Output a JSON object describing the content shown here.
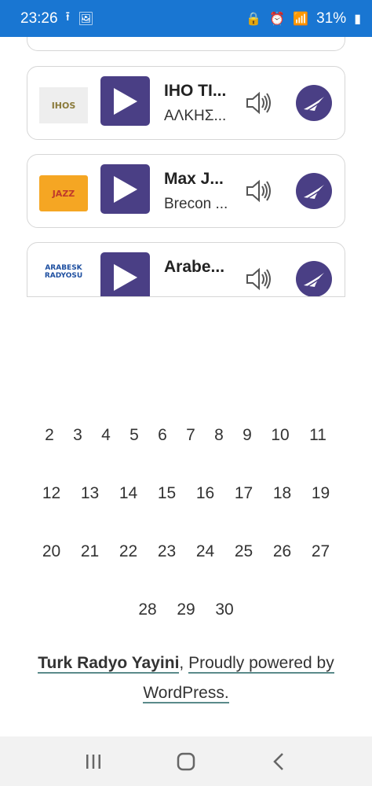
{
  "status_bar": {
    "time": "23:26",
    "battery": "31%",
    "icons_left": [
      "upload-icon",
      "image-icon"
    ],
    "icons_right": [
      "lock-icon",
      "alarm-icon",
      "wifi-icon",
      "signal-icon",
      "battery-icon"
    ]
  },
  "stations": [
    {
      "title": "IHO TI...",
      "subtitle": "ΑΛΚΗΣ...",
      "logo_text": "IHOS"
    },
    {
      "title": "Max J...",
      "subtitle": "Brecon ...",
      "logo_text": "JAZZ"
    },
    {
      "title": "Arabe...",
      "subtitle": "",
      "logo_text": "ARABESK RADYOSU"
    }
  ],
  "pagination": {
    "rows": [
      [
        "2",
        "3",
        "4",
        "5",
        "6",
        "7",
        "8",
        "9",
        "10",
        "11"
      ],
      [
        "12",
        "13",
        "14",
        "15",
        "16",
        "17",
        "18",
        "19"
      ],
      [
        "20",
        "21",
        "22",
        "23",
        "24",
        "25",
        "26",
        "27"
      ],
      [
        "28",
        "29",
        "30"
      ]
    ]
  },
  "footer": {
    "site_name": "Turk Radyo Yayini",
    "separator": ",",
    "powered_by": "Proudly powered by WordPress."
  },
  "colors": {
    "status_bar": "#1976d2",
    "accent": "#4a3f85"
  }
}
